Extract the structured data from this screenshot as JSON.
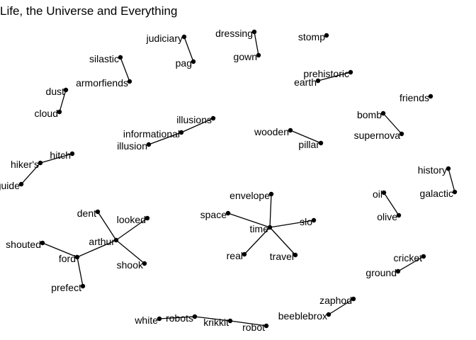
{
  "title": "Life, the Universe and Everything",
  "colors": {
    "edge": "#000000",
    "node": "#000000",
    "text": "#000000",
    "background": "#ffffff"
  },
  "nodes": [
    {
      "id": "judiciary",
      "label": "judiciary"
    },
    {
      "id": "pag",
      "label": "pag"
    },
    {
      "id": "dressing",
      "label": "dressing"
    },
    {
      "id": "gown",
      "label": "gown"
    },
    {
      "id": "stomp",
      "label": "stomp"
    },
    {
      "id": "silastic",
      "label": "silastic"
    },
    {
      "id": "armorfiends",
      "label": "armorfiends"
    },
    {
      "id": "prehistoric",
      "label": "prehistoric"
    },
    {
      "id": "earth",
      "label": "earth"
    },
    {
      "id": "dust",
      "label": "dust"
    },
    {
      "id": "cloud",
      "label": "cloud"
    },
    {
      "id": "friends",
      "label": "friends"
    },
    {
      "id": "bomb",
      "label": "bomb"
    },
    {
      "id": "supernova",
      "label": "supernova"
    },
    {
      "id": "illusions",
      "label": "illusions"
    },
    {
      "id": "informational",
      "label": "informational"
    },
    {
      "id": "illusion",
      "label": "illusion"
    },
    {
      "id": "wooden",
      "label": "wooden"
    },
    {
      "id": "pillar",
      "label": "pillar"
    },
    {
      "id": "hitch",
      "label": "hitch"
    },
    {
      "id": "hikers",
      "label": "hiker's"
    },
    {
      "id": "guide",
      "label": "guide"
    },
    {
      "id": "history",
      "label": "history"
    },
    {
      "id": "galactic",
      "label": "galactic"
    },
    {
      "id": "envelope",
      "label": "envelope"
    },
    {
      "id": "space",
      "label": "space"
    },
    {
      "id": "time",
      "label": "time"
    },
    {
      "id": "slo",
      "label": "slo"
    },
    {
      "id": "real",
      "label": "real"
    },
    {
      "id": "travel",
      "label": "travel"
    },
    {
      "id": "oil",
      "label": "oil"
    },
    {
      "id": "olive",
      "label": "olive"
    },
    {
      "id": "dent",
      "label": "dent"
    },
    {
      "id": "looked",
      "label": "looked"
    },
    {
      "id": "arthur",
      "label": "arthur"
    },
    {
      "id": "shouted",
      "label": "shouted"
    },
    {
      "id": "ford",
      "label": "ford"
    },
    {
      "id": "shook",
      "label": "shook"
    },
    {
      "id": "prefect",
      "label": "prefect"
    },
    {
      "id": "cricket",
      "label": "cricket"
    },
    {
      "id": "ground",
      "label": "ground"
    },
    {
      "id": "zaphod",
      "label": "zaphod"
    },
    {
      "id": "beeblebrox",
      "label": "beeblebrox"
    },
    {
      "id": "white",
      "label": "white"
    },
    {
      "id": "robots",
      "label": "robots"
    },
    {
      "id": "krikkit",
      "label": "krikkit"
    },
    {
      "id": "robot",
      "label": "robot"
    }
  ],
  "edges": [
    [
      "judiciary",
      "pag"
    ],
    [
      "dressing",
      "gown"
    ],
    [
      "silastic",
      "armorfiends"
    ],
    [
      "prehistoric",
      "earth"
    ],
    [
      "dust",
      "cloud"
    ],
    [
      "bomb",
      "supernova"
    ],
    [
      "illusions",
      "informational"
    ],
    [
      "informational",
      "illusion"
    ],
    [
      "wooden",
      "pillar"
    ],
    [
      "hitch",
      "hikers"
    ],
    [
      "hikers",
      "guide"
    ],
    [
      "history",
      "galactic"
    ],
    [
      "envelope",
      "time"
    ],
    [
      "space",
      "time"
    ],
    [
      "slo",
      "time"
    ],
    [
      "real",
      "time"
    ],
    [
      "travel",
      "time"
    ],
    [
      "oil",
      "olive"
    ],
    [
      "dent",
      "arthur"
    ],
    [
      "looked",
      "arthur"
    ],
    [
      "shook",
      "arthur"
    ],
    [
      "arthur",
      "ford"
    ],
    [
      "shouted",
      "ford"
    ],
    [
      "ford",
      "prefect"
    ],
    [
      "cricket",
      "ground"
    ],
    [
      "zaphod",
      "beeblebrox"
    ],
    [
      "white",
      "robots"
    ],
    [
      "robots",
      "krikkit"
    ],
    [
      "krikkit",
      "robot"
    ]
  ]
}
